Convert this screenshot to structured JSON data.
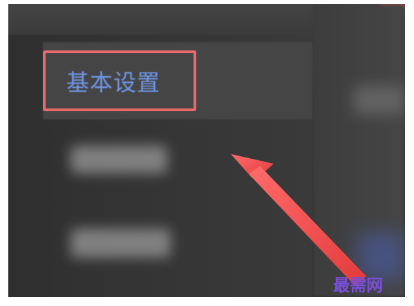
{
  "menu": {
    "selected_item_label": "基本设置"
  },
  "annotation": {
    "highlight_color": "#e86a6a",
    "arrow_color": "#e94e4e",
    "arrow_icon": "pointer-arrow"
  },
  "watermark": {
    "text": "最需网",
    "color": "#7a4fd6"
  },
  "theme": {
    "background": "#333333",
    "label_color": "#6f97e8"
  }
}
